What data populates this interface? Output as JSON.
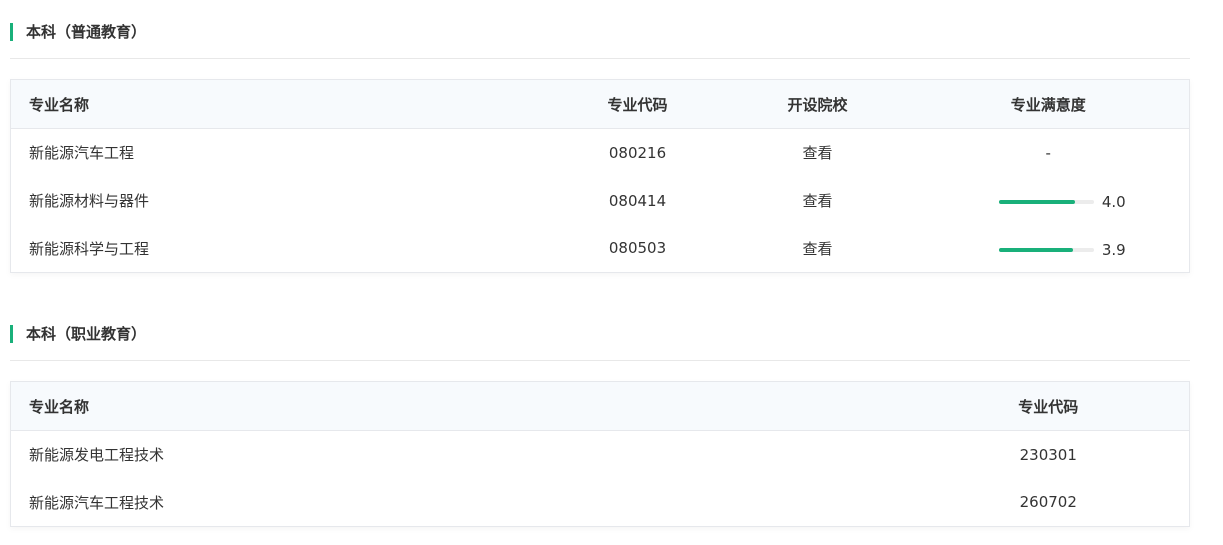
{
  "section1": {
    "title": "本科（普通教育）",
    "headers": [
      "专业名称",
      "专业代码",
      "开设院校",
      "专业满意度"
    ],
    "rows": [
      {
        "name": "新能源汽车工程",
        "code": "080216",
        "school": "查看",
        "satisfaction": "-",
        "fraction": null
      },
      {
        "name": "新能源材料与器件",
        "code": "080414",
        "school": "查看",
        "satisfaction": "4.0",
        "fraction": 0.8
      },
      {
        "name": "新能源科学与工程",
        "code": "080503",
        "school": "查看",
        "satisfaction": "3.9",
        "fraction": 0.78
      }
    ]
  },
  "section2": {
    "title": "本科（职业教育）",
    "headers": [
      "专业名称",
      "专业代码"
    ],
    "rows": [
      {
        "name": "新能源发电工程技术",
        "code": "230301"
      },
      {
        "name": "新能源汽车工程技术",
        "code": "260702"
      }
    ]
  },
  "colors": {
    "accent": "#19b07a"
  }
}
